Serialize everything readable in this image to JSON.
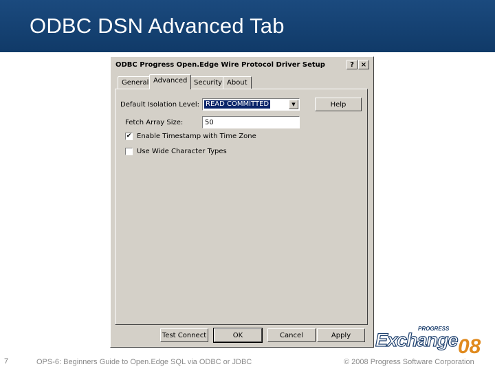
{
  "slide": {
    "title": "ODBC DSN Advanced Tab",
    "page_number": "7",
    "footer_text": "OPS-6: Beginners Guide to Open.Edge SQL via ODBC or JDBC",
    "copyright": "© 2008 Progress Software Corporation",
    "header_color": "#1b4a7e"
  },
  "logo": {
    "progress": "PROGRESS",
    "exchange": "Exchange",
    "year": "08"
  },
  "dialog": {
    "title": "ODBC Progress Open.Edge Wire Protocol Driver Setup",
    "help_title_button": "?",
    "close_title_button": "×",
    "tabs": [
      {
        "label": "General",
        "active": false
      },
      {
        "label": "Advanced",
        "active": true
      },
      {
        "label": "Security",
        "active": false
      },
      {
        "label": "About",
        "active": false
      }
    ],
    "fields": {
      "isolation_label": "Default Isolation Level:",
      "isolation_value": "READ COMMITTED",
      "fetch_label": "Fetch Array Size:",
      "fetch_value": "50"
    },
    "checkboxes": [
      {
        "label": "Enable Timestamp with Time Zone",
        "checked": true,
        "mark": "✔"
      },
      {
        "label": "Use Wide Character Types",
        "checked": false,
        "mark": ""
      }
    ],
    "buttons": {
      "help": "Help",
      "test_connect": "Test Connect",
      "ok": "OK",
      "cancel": "Cancel",
      "apply": "Apply"
    }
  }
}
